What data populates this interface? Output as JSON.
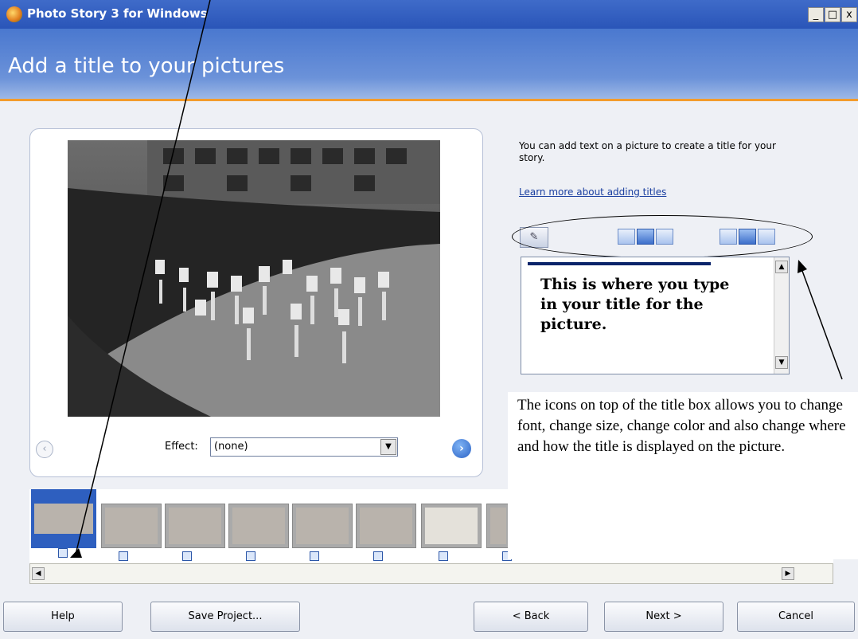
{
  "window": {
    "title": "Photo Story 3 for Windows",
    "controls": {
      "minimize": "_",
      "maximize": "□",
      "close": "x"
    }
  },
  "header": {
    "title": "Add a title to your pictures"
  },
  "preview": {
    "effect_label": "Effect:",
    "effect_value": "(none)",
    "prev_icon": "chevron-left-icon",
    "next_icon": "chevron-right-icon"
  },
  "side": {
    "help_text": "You can add text on a picture to create a title for your story.",
    "learn_link": "Learn more about adding titles"
  },
  "toolbar": {
    "font_button_icon": "font-icon",
    "align_icons": [
      "align-left-icon",
      "align-center-icon",
      "align-right-icon"
    ],
    "position_icons": [
      "position-top-icon",
      "position-middle-icon",
      "position-bottom-icon"
    ],
    "selected": [
      "align-center-icon",
      "position-middle-icon"
    ]
  },
  "title_box": {
    "text": "This is where you type in your title for the picture."
  },
  "annotation": {
    "text": "The icons on top of the title box allows you to change font, change size, change color and also change where and how the title is displayed on the picture."
  },
  "filmstrip": {
    "thumbnail_count": 8,
    "selected_index": 0
  },
  "buttons": {
    "help": "Help",
    "save_project": "Save Project...",
    "back": "< Back",
    "next": "Next >",
    "cancel": "Cancel"
  },
  "colors": {
    "header_blue": "#4a78cf",
    "accent_orange": "#f39b2c",
    "selection_blue": "#2e5fbf"
  }
}
